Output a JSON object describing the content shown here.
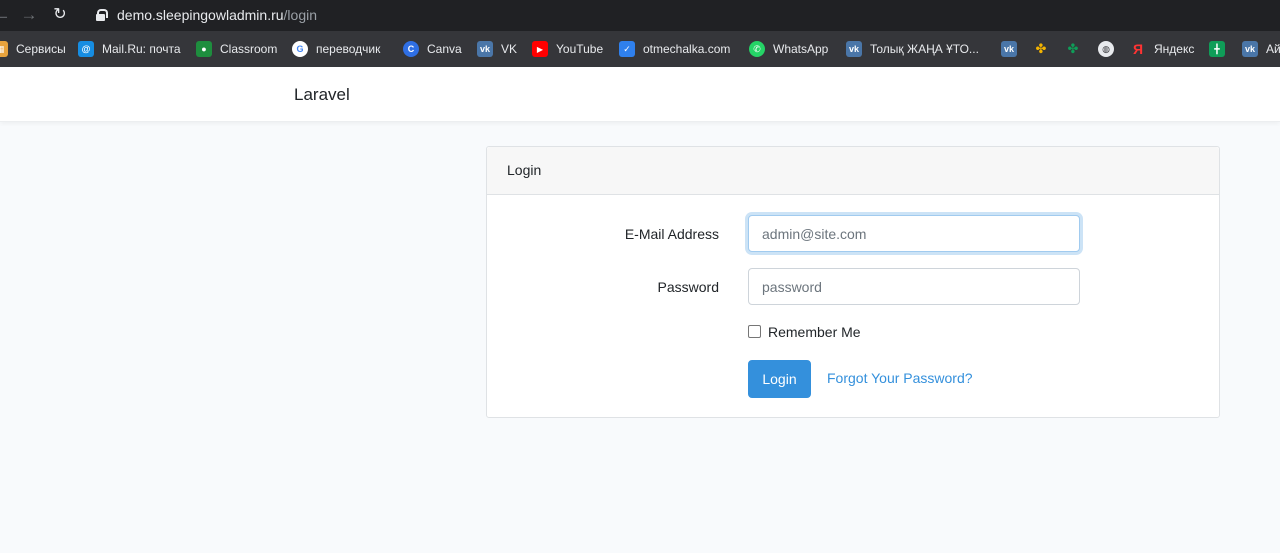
{
  "browser": {
    "url_domain": "demo.sleepingowladmin.ru",
    "url_path": "/login",
    "bookmarks": [
      {
        "label": "Сервисы",
        "icon": "apps-grid-icon",
        "color": "#e8a33d"
      },
      {
        "label": "Mail.Ru: почта",
        "icon": "mailru-icon",
        "color": "#168de2"
      },
      {
        "label": "Classroom",
        "icon": "classroom-icon",
        "color": "#1e8e3e"
      },
      {
        "label": "переводчик",
        "icon": "google-translate-icon",
        "color": "#4285f4"
      },
      {
        "label": "Canva",
        "icon": "canva-icon",
        "color": "#00c4cc"
      },
      {
        "label": "VK",
        "icon": "vk-icon",
        "color": "#4a76a8"
      },
      {
        "label": "YouTube",
        "icon": "youtube-icon",
        "color": "#ff0000"
      },
      {
        "label": "otmechalka.com",
        "icon": "checkmark-icon",
        "color": "#2f80ed"
      },
      {
        "label": "WhatsApp",
        "icon": "whatsapp-icon",
        "color": "#25d366"
      },
      {
        "label": "Толық ЖАҢА ҰТО...",
        "icon": "vk-icon",
        "color": "#4a76a8"
      },
      {
        "label": "",
        "icon": "vk-icon",
        "color": "#4a76a8"
      },
      {
        "label": "",
        "icon": "pinwheel-icon",
        "color": "#f4b400"
      },
      {
        "label": "",
        "icon": "pinwheel-icon",
        "color": "#0f9d58"
      },
      {
        "label": "",
        "icon": "globe-icon",
        "color": "#e8eaed"
      },
      {
        "label": "Яндекс",
        "icon": "yandex-icon",
        "color": "#ff0000"
      },
      {
        "label": "",
        "icon": "google-sheets-icon",
        "color": "#0f9d58"
      },
      {
        "label": "Ай",
        "icon": "vk-icon",
        "color": "#4a76a8"
      }
    ]
  },
  "navbar": {
    "brand": "Laravel"
  },
  "login_card": {
    "header": "Login",
    "email_label": "E-Mail Address",
    "email_placeholder": "admin@site.com",
    "password_label": "Password",
    "password_placeholder": "password",
    "remember_label": "Remember Me",
    "submit_label": "Login",
    "forgot_label": "Forgot Your Password?"
  },
  "colors": {
    "accent": "#3490dc",
    "page_bg": "#f8fafc"
  }
}
